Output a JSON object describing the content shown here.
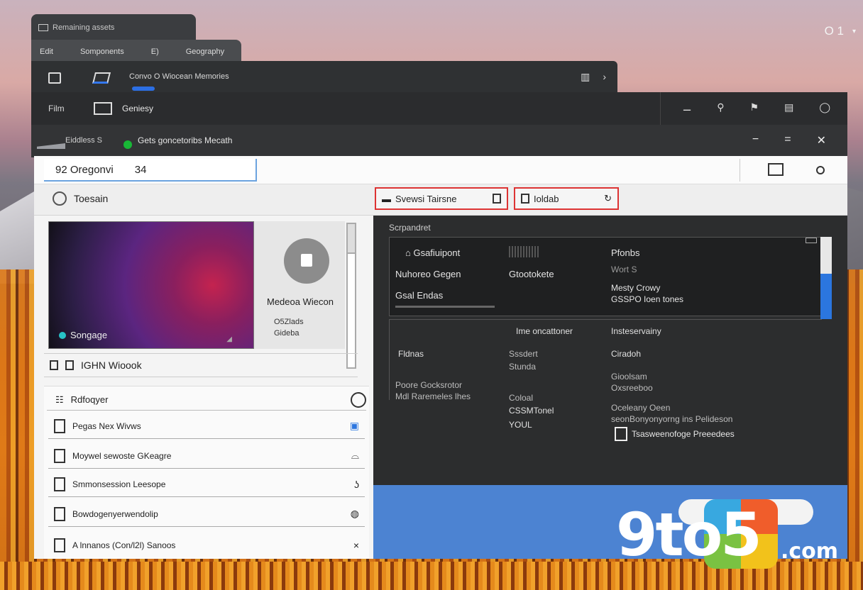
{
  "desktop": {
    "top_right": {
      "label": "O 1",
      "chevron": "▾"
    }
  },
  "windows": {
    "w1": {
      "title": "Remaining assets"
    },
    "tabs": [
      "Edit",
      "Somponents",
      "E)",
      "Geography"
    ],
    "w2": {
      "label": "Convo O Wiocean Memories",
      "icons": [
        "ruler-icon",
        "chevron-right-icon"
      ]
    },
    "w3": {
      "left": "Film",
      "label": "Geniesy",
      "icons": [
        "dash-icon",
        "pin-icon",
        "flag-icon",
        "doc-icon",
        "power-icon"
      ]
    },
    "w4": {
      "left": "Eiddless  S",
      "label": "Gets goncetoribs Mecath",
      "controls": [
        "minimize",
        "restore",
        "close"
      ]
    }
  },
  "address": {
    "value": "Oregonvi",
    "suffix": "34",
    "prefix": "92"
  },
  "toolbar": {
    "search": "Toesain",
    "tab1": "Svewsi Tairsne",
    "tab2": "Ioldab"
  },
  "preview": {
    "label": "Songage",
    "name": "Medeoa Wiecon",
    "meta1": "O5Zlads",
    "meta2": "Gideba"
  },
  "table_header": "IGHN Wioook",
  "list": {
    "header": "Rdfoqyer",
    "rows": [
      {
        "label": "Pegas Nex Wivws",
        "icon_right": "bookmark-icon"
      },
      {
        "label": "Moywel sewoste GKeagre",
        "icon_right": "bell-icon"
      },
      {
        "label": "Smmonsession Leesope",
        "icon_right": "hook-icon"
      },
      {
        "label": "Bowdogenyerwendolip",
        "icon_right": "globe-icon"
      },
      {
        "label": "A lnnanos (Con/l2l) Sanoos",
        "icon_right": "close-icon"
      }
    ]
  },
  "panel": {
    "header": "Scrpandret",
    "card": {
      "c1": "Gsafiuipont",
      "c2": "Nuhoreo Gegen",
      "c3": "Gsal  Endas",
      "m1": "Gtootokete",
      "r1": "Pfonbs",
      "r2": "Wort S",
      "r3": "Mesty Crowy",
      "r4": "GSSPO Ioen tones"
    },
    "grid": {
      "h1": "Ime oncattoner",
      "h2": "Insteservainy",
      "a1": "Fldnas",
      "a2": "Poore Gocksrotor",
      "a3": "Mdl Raremeles lhes",
      "b1": "Sssdert",
      "b2": "Stunda",
      "b3": "Coloal",
      "b4": "CSSMTonel",
      "b5": "YOUL",
      "c1": "Ciradoh",
      "c2": "Gioolsam",
      "c3": "Oxsreeboo",
      "c4": "Oceleany Oeen",
      "c5": "seonBonyonyorng ins Pelideson"
    },
    "footer": "Tsasweenofoge Preeedees"
  },
  "watermark": {
    "brand": "9to5",
    "tld": ".com"
  },
  "colors": {
    "accent": "#2b76df",
    "highlight_border": "#d33333",
    "status_dot": "#18b836"
  }
}
